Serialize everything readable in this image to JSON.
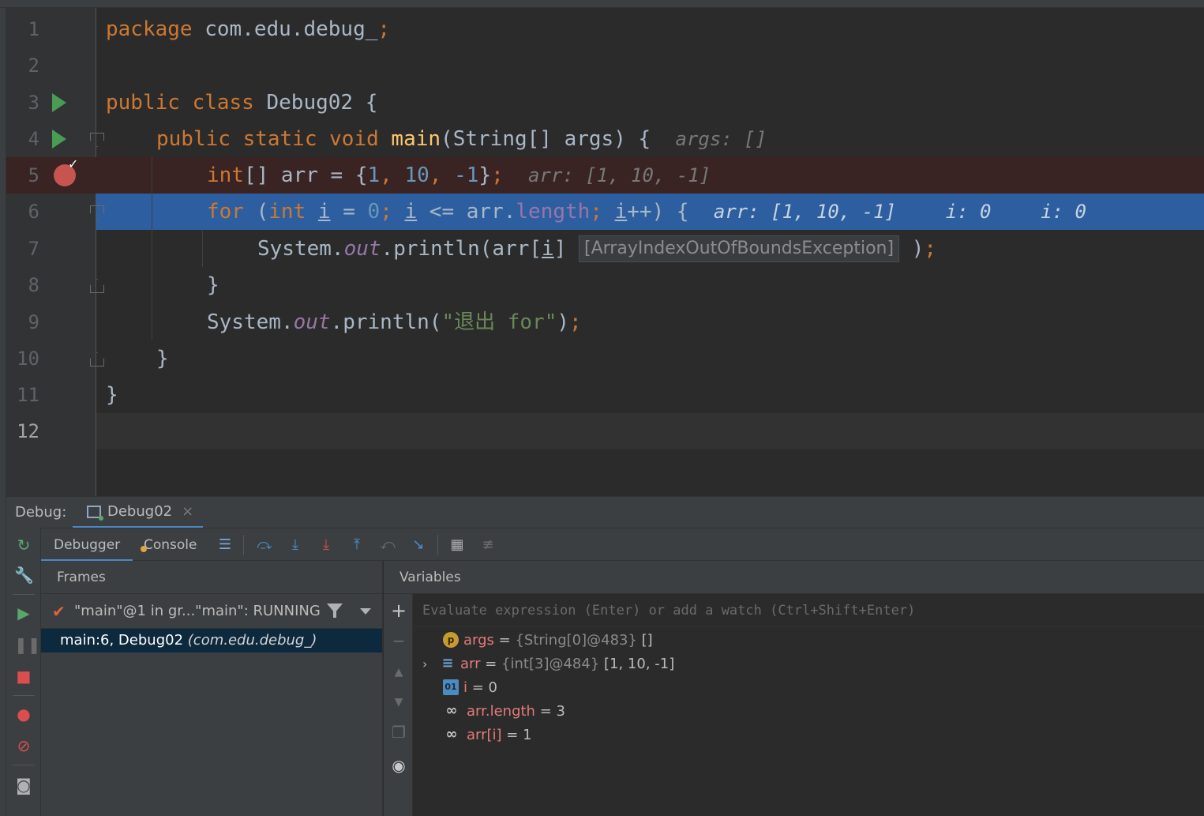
{
  "editor": {
    "lines": [
      {
        "n": "1"
      },
      {
        "n": "2"
      },
      {
        "n": "3"
      },
      {
        "n": "4"
      },
      {
        "n": "5"
      },
      {
        "n": "6"
      },
      {
        "n": "7"
      },
      {
        "n": "8"
      },
      {
        "n": "9"
      },
      {
        "n": "10"
      },
      {
        "n": "11"
      },
      {
        "n": "12"
      }
    ],
    "l1": {
      "kw": "package",
      "rest": " com.edu.debug_",
      "semi": ";"
    },
    "l3": {
      "kw": "public class",
      "rest": " Debug02 {"
    },
    "l4": {
      "kw": "public static void",
      "fn": " main",
      "rest": "(String[] args) {",
      "hint": "args: []"
    },
    "l5": {
      "kw": "int",
      "a": "[] arr = {",
      "n1": "1",
      "c1": ", ",
      "n2": "10",
      "c2": ", ",
      "n3": "-1",
      "b": "}",
      "semi": ";",
      "hint": "arr: [1, 10, -1]"
    },
    "l6": {
      "kw": "for",
      "a": " (",
      "kw2": "int",
      "i1": "i",
      "eq": " = ",
      "zero": "0",
      "s1": "; ",
      "i2": "i",
      "le": " <= arr.",
      "len": "length",
      "s2": "; ",
      "i3": "i",
      "inc": "++) {",
      "hint1": "arr: [1, 10, -1]",
      "hint2": "i: 0",
      "hint3": "i: 0"
    },
    "l7": {
      "pre": "System.",
      "out": "out",
      "mid": ".println(arr[",
      "i": "i",
      "close": "]",
      "exc": "[ArrayIndexOutOfBoundsException]",
      "end": ")",
      "semi": ";"
    },
    "l8": {
      "text": "}"
    },
    "l9": {
      "pre": "System.",
      "out": "out",
      "mid": ".println(",
      "str": "\"退出 for\"",
      "end": ")",
      "semi": ";"
    },
    "l10": {
      "text": "}"
    },
    "l11": {
      "text": "}"
    }
  },
  "debug": {
    "label": "Debug:",
    "tab_name": "Debug02",
    "tab_close": "×",
    "tabs": {
      "debugger": "Debugger",
      "console": "Console"
    },
    "frames_title": "Frames",
    "thread": "\"main\"@1 in gr...\"main\": RUNNING",
    "frame": {
      "location": "main:6, Debug02",
      "package": "(com.edu.debug_)"
    },
    "variables_title": "Variables",
    "eval_placeholder": "Evaluate expression (Enter) or add a watch (Ctrl+Shift+Enter)",
    "vars": [
      {
        "name": "args",
        "eq": " = ",
        "type": "{String[0]@483}",
        "value": " []",
        "icon": "p-icon"
      },
      {
        "name": "arr",
        "eq": " = ",
        "type": "{int[3]@484}",
        "value": " [1, 10, -1]",
        "icon": "array-icon"
      },
      {
        "name": "i",
        "eq": " = ",
        "type": "",
        "value": "0",
        "icon": "primitive-icon"
      },
      {
        "name": "arr.length",
        "eq": " = ",
        "type": "",
        "value": "3",
        "icon": "watch-icon"
      },
      {
        "name": "arr[i]",
        "eq": " = ",
        "type": "",
        "value": "1",
        "icon": "watch-icon"
      }
    ]
  },
  "colors": {
    "keyword": "#cc7832",
    "number": "#6897bb",
    "string": "#6a8759",
    "execution_line": "#2d5fa0",
    "breakpoint": "#c75450",
    "run_arrow": "#499c54"
  }
}
